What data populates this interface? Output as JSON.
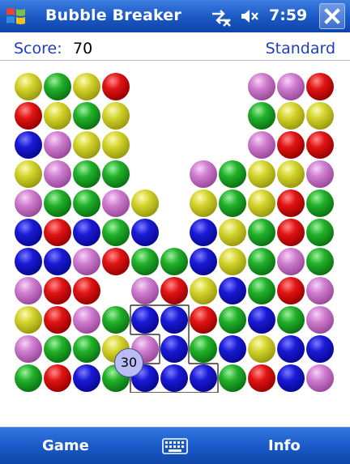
{
  "titlebar": {
    "title": "Bubble Breaker",
    "time": "7:59"
  },
  "status": {
    "score_label": "Score:",
    "score_value": "70",
    "mode": "Standard"
  },
  "board": {
    "columns": 11,
    "rows": 11,
    "grid": [
      [
        "yellow",
        "green",
        "yellow",
        "red",
        null,
        null,
        null,
        null,
        "purple",
        "purple",
        "red"
      ],
      [
        "red",
        "yellow",
        "green",
        "yellow",
        null,
        null,
        null,
        null,
        "green",
        "yellow",
        "yellow"
      ],
      [
        "blue",
        "purple",
        "yellow",
        "yellow",
        null,
        null,
        null,
        null,
        "purple",
        "red",
        "red"
      ],
      [
        "yellow",
        "purple",
        "green",
        "green",
        null,
        null,
        "purple",
        "green",
        "yellow",
        "yellow",
        "purple"
      ],
      [
        "purple",
        "green",
        "green",
        "purple",
        "yellow",
        null,
        "yellow",
        "green",
        "yellow",
        "red",
        "green"
      ],
      [
        "blue",
        "red",
        "blue",
        "green",
        "blue",
        null,
        "blue",
        "yellow",
        "green",
        "red",
        "green"
      ],
      [
        "blue",
        "blue",
        "purple",
        "red",
        "green",
        "green",
        "blue",
        "yellow",
        "green",
        "purple",
        "green"
      ],
      [
        "purple",
        "red",
        "red",
        null,
        "purple",
        "red",
        "yellow",
        "blue",
        "green",
        "red",
        "purple"
      ],
      [
        "yellow",
        "red",
        "purple",
        "green",
        "blue",
        "blue",
        "red",
        "green",
        "blue",
        "green",
        "purple"
      ],
      [
        "purple",
        "green",
        "green",
        "yellow",
        "purple",
        "blue",
        "green",
        "blue",
        "yellow",
        "blue",
        "blue"
      ],
      [
        "green",
        "red",
        "blue",
        "green",
        "blue",
        "blue",
        "blue",
        "green",
        "red",
        "blue",
        "purple"
      ]
    ],
    "selection_points": "30",
    "selected_color": "blue"
  },
  "softkeys": {
    "left": "Game",
    "right": "Info"
  }
}
